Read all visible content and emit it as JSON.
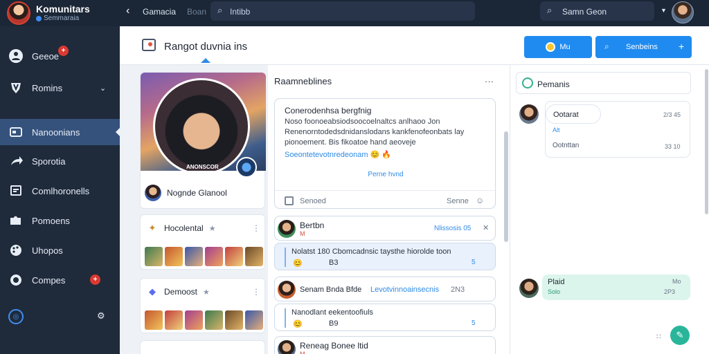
{
  "app": {
    "title": "Komunitars",
    "subtitle": "Semmaraia"
  },
  "topbar": {
    "crumb": "Gamacia",
    "crumb_muted": "Boan",
    "search_text": "Intibb",
    "search2_text": "Samn Geon"
  },
  "sidebar": {
    "items": [
      {
        "label": "Geeoe",
        "icon": "person-icon",
        "badge": "+"
      },
      {
        "label": "Romins",
        "icon": "shield-icon",
        "chevron": "⌄"
      },
      {
        "label": "Nanoonians",
        "icon": "card-icon"
      },
      {
        "label": "Sporotia",
        "icon": "arrow-icon"
      },
      {
        "label": "Comlhoronells",
        "icon": "chat-icon"
      },
      {
        "label": "Pomoens",
        "icon": "puzzle-icon"
      },
      {
        "label": "Uhopos",
        "icon": "palette-icon"
      },
      {
        "label": "Compes",
        "icon": "record-icon",
        "badge": "+"
      }
    ]
  },
  "header": {
    "title": "Rangot duvnia ins",
    "btn1_label": "Mu",
    "btn2_label": "Senbeins",
    "btn2_plus": "+"
  },
  "profile": {
    "tag": "ANONSCOR",
    "name": "Nognde Glanool"
  },
  "groups": [
    {
      "name": "Hocolental",
      "pin": "★",
      "dots": "⋮"
    },
    {
      "name": "Demoost",
      "pin": "★",
      "dots": "⋮"
    }
  ],
  "middle": {
    "title": "Raamneblines",
    "dots": "···",
    "composer": {
      "title": "Conerodenhsa bergfnig",
      "body": "Noso foonoeabsiodsoocoelnaltcs anlhaoo Jon Renenorntodedsdnidanslodans kankfenofeonbats lay pionoement. Bis fikoatoe hand aeoveje",
      "link": "Soeontetevotnredeonam",
      "emoji": "😊 🔥",
      "center": "Perne hvnd",
      "foot_left": "Senoed",
      "foot_right": "Senne"
    },
    "posts": [
      {
        "name": "Bertbn",
        "sub": "M",
        "right": "Nlissosis 05",
        "extra": "✕"
      },
      {
        "name": "Senam Bnda Bfde",
        "link": "Levotvinnoainsecnis",
        "right": "2N3"
      }
    ],
    "replies": [
      {
        "text": "Nolatst 180 Cbomcadnsic taysthe hiorolde toon",
        "emoji": "😊",
        "meta": "B3",
        "count": "5"
      },
      {
        "text": "Nanodlant eekentoofiuls",
        "emoji": "😊",
        "meta": "B9",
        "count": "5"
      }
    ],
    "post3": {
      "name": "Reneag Bonee ltid",
      "sub": "M"
    }
  },
  "right": {
    "head": "Pemanis",
    "msg": {
      "bubble": "Ootarat",
      "time1": "2/3 45",
      "sub": "Alt",
      "line2": "Ootnttan",
      "time2": "33 10"
    },
    "green": {
      "name": "Plaid",
      "status": "Solo",
      "time1": "Mo",
      "time2": "2P3"
    },
    "fab": "✎",
    "dots": "∷"
  },
  "colors": {
    "accent": "#1f8bf0",
    "sidebar_bg": "#1f2a3b",
    "topbar_bg": "#1b2636",
    "active_item": "#35527c",
    "badge": "#d93a32",
    "green": "#29b59a"
  }
}
